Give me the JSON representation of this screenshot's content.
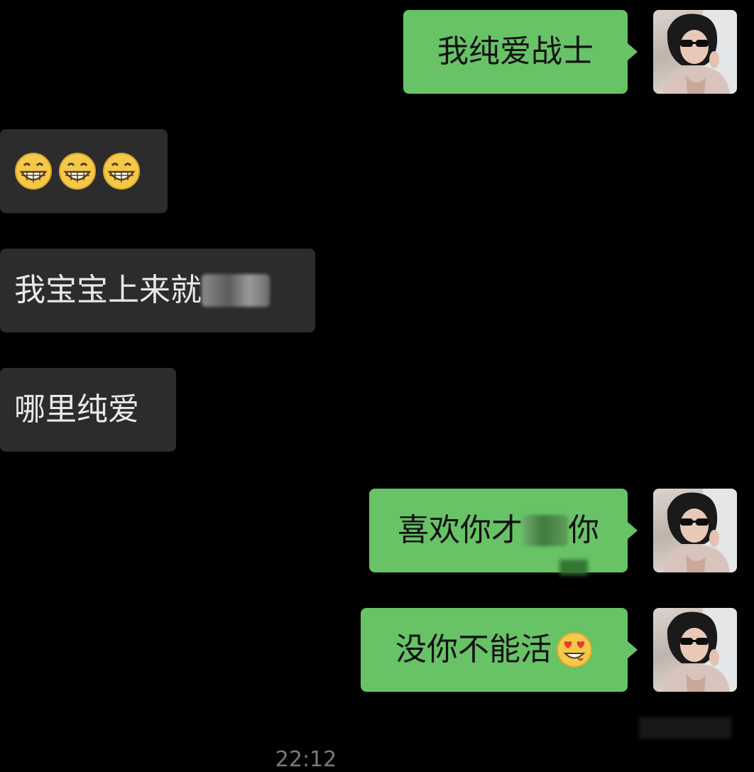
{
  "messages": [
    {
      "side": "out",
      "text": "我纯爱战士"
    },
    {
      "side": "in",
      "emoji": [
        "grinning-face",
        "grinning-face",
        "grinning-face"
      ]
    },
    {
      "side": "in",
      "text": "我宝宝上来就",
      "redacted": true
    },
    {
      "side": "in",
      "text": "哪里纯爱"
    },
    {
      "side": "out",
      "text_before": "喜欢你才",
      "text_after": "你",
      "redacted": true
    },
    {
      "side": "out",
      "text": "没你不能活",
      "emoji": "heart-eyes-face"
    }
  ],
  "timestamp": "22:12",
  "colors": {
    "background": "#000000",
    "outgoing_bubble": "#67c366",
    "incoming_bubble": "#2c2c2c"
  }
}
